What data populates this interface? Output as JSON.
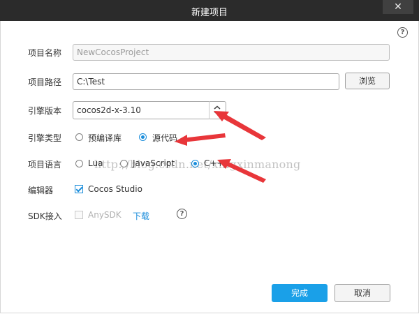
{
  "dialog": {
    "title": "新建项目",
    "close_glyph": "✕",
    "help_glyph": "?"
  },
  "form": {
    "project_name": {
      "label": "项目名称",
      "value": "NewCocosProject"
    },
    "project_path": {
      "label": "项目路径",
      "value": "C:\\Test",
      "browse_label": "浏览"
    },
    "engine_version": {
      "label": "引擎版本",
      "selected": "cocos2d-x-3.10"
    },
    "engine_type": {
      "label": "引擎类型",
      "options": [
        {
          "label": "预编译库",
          "checked": false
        },
        {
          "label": "源代码",
          "checked": true
        }
      ]
    },
    "language": {
      "label": "项目语言",
      "options": [
        {
          "label": "Lua",
          "checked": false
        },
        {
          "label": "JavaScript",
          "checked": false
        },
        {
          "label": "C++",
          "checked": true
        }
      ]
    },
    "editor": {
      "label": "编辑器",
      "option": "Cocos Studio",
      "checked": true
    },
    "sdk": {
      "label": "SDK接入",
      "option": "AnySDK",
      "checked": false,
      "download_label": "下载"
    }
  },
  "footer": {
    "finish_label": "完成",
    "cancel_label": "取消"
  },
  "watermark": "http://blog.csdn.net/xingxinmanong",
  "colors": {
    "titlebar": "#2b2b2b",
    "accent": "#1a8ddb",
    "primary_button": "#1aa0e8",
    "annotation_arrow": "#e8363a"
  }
}
